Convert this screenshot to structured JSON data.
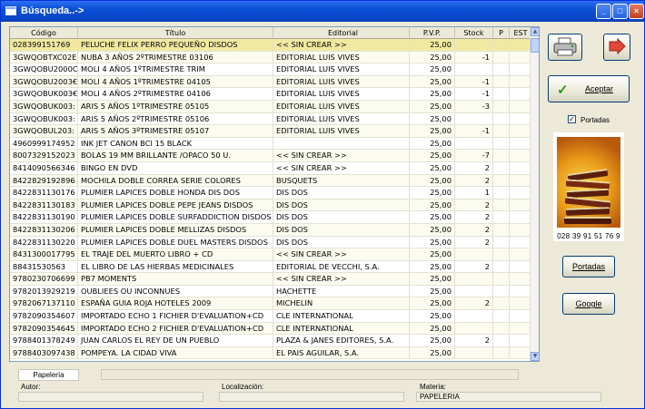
{
  "window": {
    "title": "Búsqueda..->",
    "min": "_",
    "max": "□",
    "close": "×"
  },
  "grid": {
    "columns": [
      "Código",
      "Título",
      "Editorial",
      "P.V.P.",
      "Stock",
      "P",
      "EST"
    ],
    "rows": [
      [
        "028399151769",
        "PELUCHE FELIX PERRO PEQUEÑO    DISDOS",
        "<< SIN CREAR >>",
        "25,00",
        "",
        ""
      ],
      [
        "3GWQOBTXC02E",
        "NUBA 3 AÑOS 2ºTRIMESTRE             03106",
        "EDITORIAL LUIS VIVES",
        "25,00",
        "-1",
        ""
      ],
      [
        "3GWQOBU2000C",
        "MOLI 4 AÑOS 1ºTRIMESTRE          TRIM",
        "EDITORIAL LUIS VIVES",
        "25,00",
        "",
        ""
      ],
      [
        "3GWQOBU2003€",
        "MOLI 4 AÑOS 1ºTRIMESTRE           04105",
        "EDITORIAL LUIS VIVES",
        "25,00",
        "-1",
        ""
      ],
      [
        "3GWQOBUK003€",
        "MOLI 4 AÑOS 2ºTRIMESTRE           04106",
        "EDITORIAL LUIS VIVES",
        "25,00",
        "-1",
        ""
      ],
      [
        "3GWQOBUK003:",
        "ARIS 5 AÑOS 1ºTRIMESTRE           05105",
        "EDITORIAL LUIS VIVES",
        "25,00",
        "-3",
        ""
      ],
      [
        "3GWQOBUK003:",
        "ARIS 5 AÑOS 2ºTRIMESTRE           05106",
        "EDITORIAL LUIS VIVES",
        "25,00",
        "",
        ""
      ],
      [
        "3GWQOBUL203:",
        "ARIS 5 AÑOS 3ºTRIMESTRE           05107",
        "EDITORIAL LUIS VIVES",
        "25,00",
        "-1",
        ""
      ],
      [
        "4960999174952",
        "INK JET CANON BCI 15 BLACK",
        "",
        "25,00",
        "",
        ""
      ],
      [
        "8007329152023",
        "BOLAS 19 MM BRILLANTE /OPACO 50 U.",
        "<< SIN CREAR >>",
        "25,00",
        "-7",
        ""
      ],
      [
        "8414090566346",
        "BINGO EN DVD",
        "<< SIN CREAR >>",
        "25,00",
        "2",
        ""
      ],
      [
        "8422829192896",
        "MOCHILA DOBLE CORREA SERIE COLORES",
        "BUSQUETS",
        "25,00",
        "2",
        ""
      ],
      [
        "8422831130176",
        "PLUMIER LAPICES DOBLE HONDA DIS DOS",
        "DIS DOS",
        "25,00",
        "1",
        ""
      ],
      [
        "8422831130183",
        "PLUMIER LAPICES DOBLE PEPE JEANS DISDOS",
        "DIS DOS",
        "25,00",
        "2",
        ""
      ],
      [
        "8422831130190",
        "PLUMIER LAPICES DOBLE SURFADDICTION DISDOS",
        "DIS DOS",
        "25,00",
        "2",
        ""
      ],
      [
        "8422831130206",
        "PLUMIER LAPICES DOBLE MELLIZAS DISDOS",
        "DIS DOS",
        "25,00",
        "2",
        ""
      ],
      [
        "8422831130220",
        "PLUMIER LAPICES DOBLE DUEL MASTERS DISDOS",
        "DIS DOS",
        "25,00",
        "2",
        ""
      ],
      [
        "8431300017795",
        "EL TRAJE DEL MUERTO LIBRO + CD",
        "<< SIN CREAR >>",
        "25,00",
        "",
        ""
      ],
      [
        "88431530563",
        "EL LIBRO DE LAS HIERBAS MEDICINALES",
        "EDITORIAL DE VECCHI, S.A.",
        "25,00",
        "2",
        ""
      ],
      [
        "9780230706699",
        "PB7 MOMENTS",
        "<< SIN CREAR >>",
        "25,00",
        "",
        ""
      ],
      [
        "9782013929219",
        "OUBLIEES OU INCONNUES",
        "HACHETTE",
        "25,00",
        "",
        ""
      ],
      [
        "9782067137110",
        "ESPAÑA GUIA ROJA HOTELES 2009",
        "MICHELIN",
        "25,00",
        "2",
        ""
      ],
      [
        "9782090354607",
        "IMPORTADO ECHO 1 FICHIER D'EVALUATION+CD",
        "CLE INTERNATIONAL",
        "25,00",
        "",
        ""
      ],
      [
        "9782090354645",
        "IMPORTADO ECHO 2 FICHIER D'EVALUATION+CD",
        "CLE INTERNATIONAL",
        "25,00",
        "",
        ""
      ],
      [
        "9788401378249",
        "JUAN CARLOS EL REY DE UN PUEBLO",
        "PLAZA & JANES EDITORES, S.A.",
        "25,00",
        "2",
        ""
      ],
      [
        "9788403097438",
        "POMPEYA. LA CIDAD VIVA",
        "EL PAIS AGUILAR, S.A.",
        "25,00",
        "",
        ""
      ]
    ]
  },
  "buttons": {
    "accept": "Aceptar",
    "portadas": "Portadas",
    "google": "Google"
  },
  "icons": {
    "print": "printer-icon",
    "exit": "exit-arrow-icon",
    "accept": "checkmark-icon"
  },
  "checkbox": {
    "label": "Portadas",
    "checked": true,
    "mark": "✓"
  },
  "cover": {
    "barcode_text": "028 39 91 51 76 9"
  },
  "footer": {
    "tab": "Papelería",
    "autor_label": "Autor:",
    "autor_value": "",
    "localizacion_label": "Localización:",
    "localizacion_value": "",
    "materia_label": "Materia:",
    "materia_value": "PAPELERIA"
  },
  "colors": {
    "selected_row": "#f1e9a1",
    "titlebar": "#0a4fd6"
  }
}
